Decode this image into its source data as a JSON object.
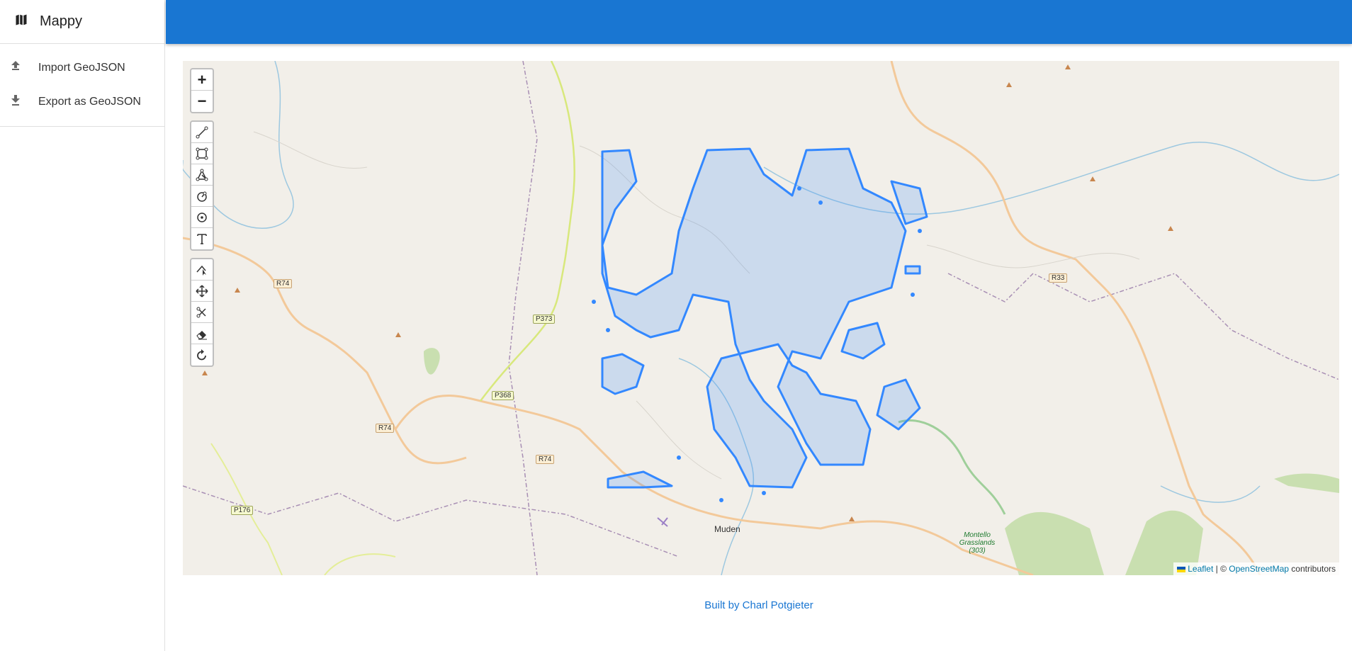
{
  "app": {
    "title": "Mappy"
  },
  "sidebar": {
    "items": [
      {
        "label": "Import GeoJSON",
        "icon": "upload-icon"
      },
      {
        "label": "Export as GeoJSON",
        "icon": "download-icon"
      }
    ]
  },
  "map": {
    "zoom_in": "+",
    "zoom_out": "−",
    "road_labels": [
      "R74",
      "R74",
      "R74",
      "P373",
      "P368",
      "P176",
      "R33"
    ],
    "place_labels": [
      "Muden",
      "Montello Grasslands (303)"
    ],
    "attribution": {
      "leaflet": "Leaflet",
      "separator": " | © ",
      "osm": "OpenStreetMap",
      "suffix": " contributors"
    },
    "draw_tools": [
      "polyline-tool-icon",
      "rectangle-tool-icon",
      "polygon-tool-icon",
      "circle-tool-icon",
      "circle-marker-tool-icon",
      "text-tool-icon"
    ],
    "edit_tools": [
      "edit-tool-icon",
      "move-tool-icon",
      "cut-tool-icon",
      "eraser-tool-icon",
      "rotate-tool-icon"
    ]
  },
  "footer": {
    "text": "Built by Charl Potgieter"
  },
  "colors": {
    "appbar": "#1976d2",
    "polygon_stroke": "#3388ff",
    "map_bg": "#f2efe9"
  }
}
